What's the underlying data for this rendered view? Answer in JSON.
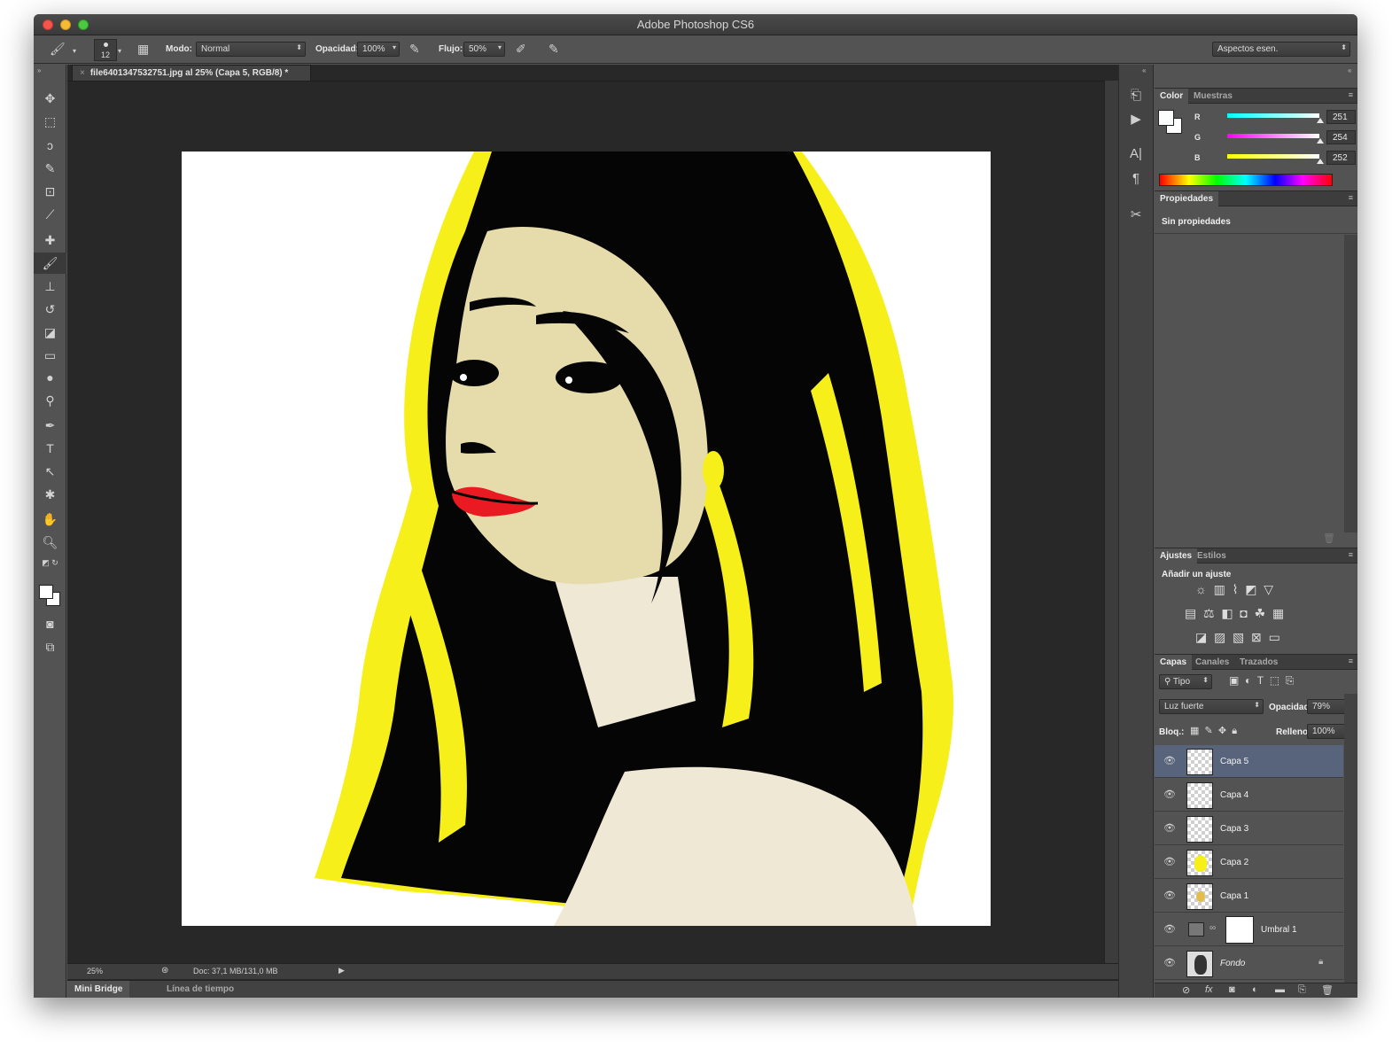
{
  "window": {
    "title": "Adobe Photoshop CS6"
  },
  "options_bar": {
    "brush_size": "12",
    "mode_label": "Modo:",
    "mode_value": "Normal",
    "opacity_label": "Opacidad:",
    "opacity_value": "100%",
    "flow_label": "Flujo:",
    "flow_value": "50%",
    "workspace": "Aspectos esen."
  },
  "document": {
    "tab_title": "file6401347532751.jpg al 25% (Capa 5, RGB/8) *",
    "close_glyph": "×"
  },
  "status_bar": {
    "zoom": "25%",
    "doc_info": "Doc: 37,1 MB/131,0 MB"
  },
  "bottom_tabs": [
    "Mini Bridge",
    "Línea de tiempo"
  ],
  "color_panel": {
    "tabs": [
      "Color",
      "Muestras"
    ],
    "channels": [
      {
        "label": "R",
        "value": "251",
        "color": "#2fe3e3"
      },
      {
        "label": "G",
        "value": "254",
        "color": "#ea2fea"
      },
      {
        "label": "B",
        "value": "252",
        "color": "#f2f22a"
      }
    ]
  },
  "properties_panel": {
    "tab": "Propiedades",
    "message": "Sin propiedades"
  },
  "adjustments_panel": {
    "tabs": [
      "Ajustes",
      "Estilos"
    ],
    "heading": "Añadir un ajuste"
  },
  "layers_panel": {
    "tabs": [
      "Capas",
      "Canales",
      "Trazados"
    ],
    "filter": "Tipo",
    "blend_mode": "Luz fuerte",
    "opacity_label": "Opacidad:",
    "opacity_value": "79%",
    "lock_label": "Bloq.:",
    "fill_label": "Relleno:",
    "fill_value": "100%",
    "layers": [
      {
        "name": "Capa 5",
        "selected": true
      },
      {
        "name": "Capa 4"
      },
      {
        "name": "Capa 3"
      },
      {
        "name": "Capa 2"
      },
      {
        "name": "Capa 1"
      },
      {
        "name": "Umbral 1"
      },
      {
        "name": "Fondo"
      }
    ]
  },
  "colors": {
    "hair_yellow": "#f6ef1a",
    "skin": "#e6dcab",
    "shoulder": "#efe8d4",
    "lips": "#ea1a22",
    "selected_layer": "#57647c"
  }
}
